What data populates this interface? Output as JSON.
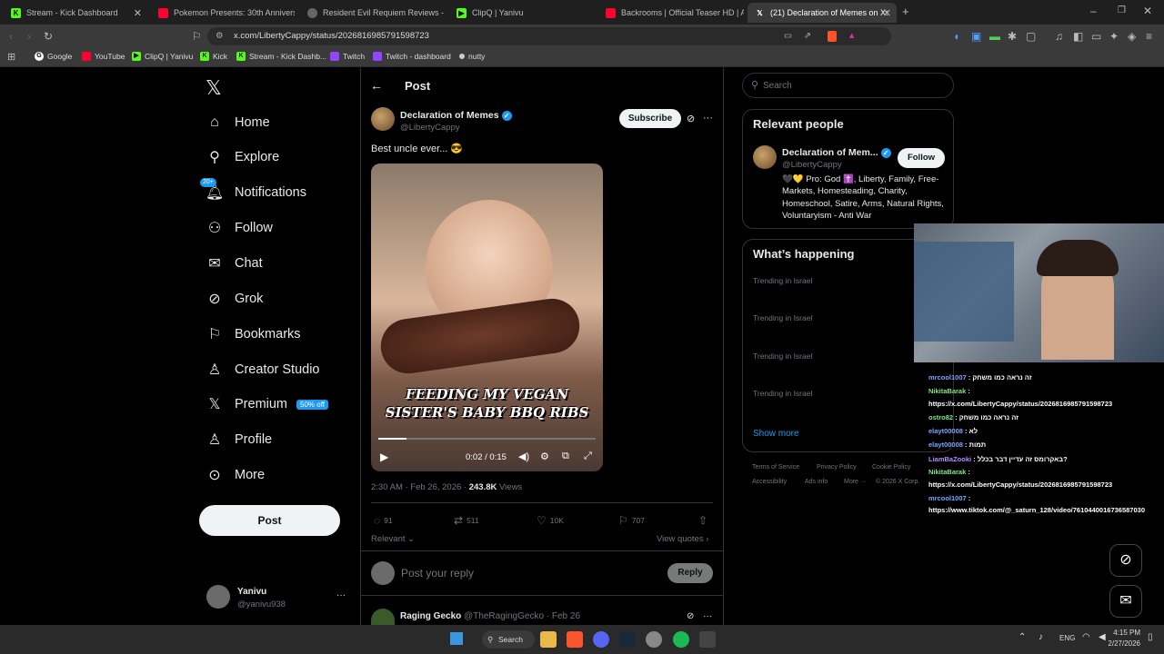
{
  "browser": {
    "tabs": [
      {
        "label": "Stream - Kick Dashboard"
      },
      {
        "label": "Pokemon Presents: 30th Anniversary"
      },
      {
        "label": "Resident Evil Requiem Reviews - Meta"
      },
      {
        "label": "ClipQ | Yanivu"
      },
      {
        "label": "Backrooms | Official Teaser HD | A24"
      },
      {
        "label": "(21) Declaration of Memes on X:"
      }
    ],
    "url": "x.com/LibertyCappy/status/2026816985791598723",
    "bookmarks": [
      "Google",
      "YouTube",
      "ClipQ | Yanivu",
      "Kick",
      "Stream - Kick Dashb...",
      "Twitch",
      "Twitch - dashboard",
      "nutty"
    ]
  },
  "nav": {
    "items": [
      {
        "label": "Home",
        "icon": "home-icon"
      },
      {
        "label": "Explore",
        "icon": "search-icon"
      },
      {
        "label": "Notifications",
        "icon": "bell-icon",
        "badge": "20+"
      },
      {
        "label": "Follow",
        "icon": "add-person-icon"
      },
      {
        "label": "Chat",
        "icon": "mail-icon"
      },
      {
        "label": "Grok",
        "icon": "grok-icon"
      },
      {
        "label": "Bookmarks",
        "icon": "bookmark-icon"
      },
      {
        "label": "Creator Studio",
        "icon": "creator-icon"
      },
      {
        "label": "Premium",
        "icon": "x-icon",
        "badge": "50% off"
      },
      {
        "label": "Profile",
        "icon": "person-icon"
      },
      {
        "label": "More",
        "icon": "more-circle-icon"
      }
    ],
    "post_label": "Post",
    "account": {
      "name": "Yanivu",
      "handle": "@yanivu938"
    }
  },
  "post": {
    "header_title": "Post",
    "author_name": "Declaration of Memes",
    "author_handle": "@LibertyCappy",
    "subscribe_label": "Subscribe",
    "text": "Best uncle ever... 😎",
    "video_caption_line1": "FEEDING MY VEGAN",
    "video_caption_line2": "SISTER'S BABY BBQ RIBS",
    "video_time": "0:02 / 0:15",
    "video_progress": 0.13,
    "timestamp": "2:30 AM · Feb 26, 2026 · ",
    "views_count": "243.8K",
    "views_label": " Views",
    "replies": "91",
    "reposts": "511",
    "likes": "10K",
    "bookmarks": "707",
    "sort_label": "Relevant",
    "view_quotes": "View quotes",
    "reply_placeholder": "Post your reply",
    "reply_button": "Reply",
    "next_author": "Raging Gecko",
    "next_handle": "@TheRagingGecko · Feb 26"
  },
  "sidebar": {
    "search_placeholder": "Search",
    "relevant_title": "Relevant people",
    "person_name": "Declaration of Mem...",
    "person_handle": "@LibertyCappy",
    "follow_label": "Follow",
    "person_bio": "🖤💛 Pro: God ✝️, Liberty, Family, Free-Markets, Homesteading, Charity, Homeschool, Satire, Arms, Natural Rights, Voluntaryism - Anti War",
    "happening_title": "What’s happening",
    "trends": [
      "Trending in Israel",
      "Trending in Israel",
      "Trending in Israel",
      "Trending in Israel"
    ],
    "show_more": "Show more",
    "footer": [
      "Terms of Service",
      "Privacy Policy",
      "Cookie Policy",
      "Accessibility",
      "Ads info",
      "More ···",
      "© 2026 X Corp."
    ]
  },
  "chat": {
    "lines": [
      {
        "user": "mrcool1007",
        "msg": ": זה נראה כמו משחק"
      },
      {
        "user": "NikitaBarak",
        "msg": ":"
      },
      {
        "user": "",
        "msg": "https://x.com/LibertyCappy/status/2026816985791598723"
      },
      {
        "user": "ostro82",
        "msg": ": זה נראה כמו משחק"
      },
      {
        "user": "elayt00008",
        "msg": ": לא"
      },
      {
        "user": "elayt00008",
        "msg": ": תמות"
      },
      {
        "user": "LiamBaZooki",
        "msg": ": באקרומס זה עדיין דבר בכלל?"
      },
      {
        "user": "NikitaBarak",
        "msg": ":"
      },
      {
        "user": "",
        "msg": "https://x.com/LibertyCappy/status/2026816985791598723"
      },
      {
        "user": "mrcool1007",
        "msg": ":"
      },
      {
        "user": "",
        "msg": "https://www.tiktok.com/@_saturn_128/video/7610440016736587030"
      }
    ]
  },
  "taskbar": {
    "search_label": "Search",
    "lang": "ENG",
    "time": "4:15 PM",
    "date": "2/27/2026"
  },
  "colors": {
    "accent": "#1d9bf0",
    "bg": "#000000",
    "muted": "#71767b"
  }
}
